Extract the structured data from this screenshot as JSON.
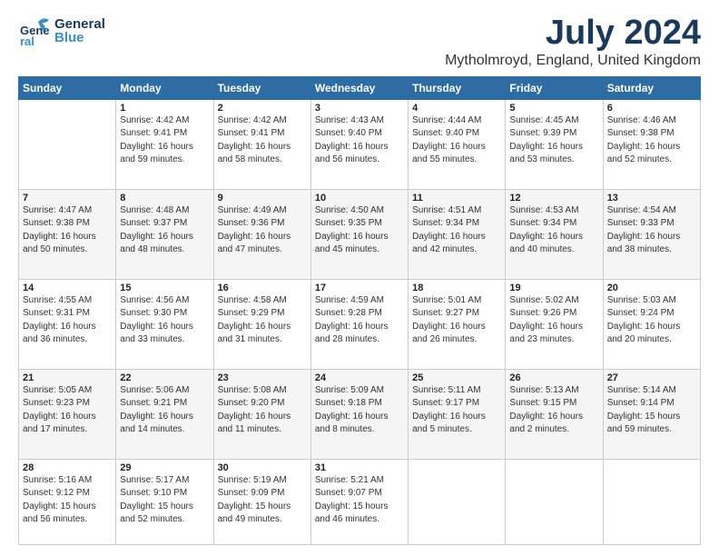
{
  "header": {
    "logo_general": "General",
    "logo_blue": "Blue",
    "month_title": "July 2024",
    "location": "Mytholmroyd, England, United Kingdom"
  },
  "days_of_week": [
    "Sunday",
    "Monday",
    "Tuesday",
    "Wednesday",
    "Thursday",
    "Friday",
    "Saturday"
  ],
  "weeks": [
    [
      {
        "day": "",
        "sunrise": "",
        "sunset": "",
        "daylight": ""
      },
      {
        "day": "1",
        "sunrise": "Sunrise: 4:42 AM",
        "sunset": "Sunset: 9:41 PM",
        "daylight": "Daylight: 16 hours and 59 minutes."
      },
      {
        "day": "2",
        "sunrise": "Sunrise: 4:42 AM",
        "sunset": "Sunset: 9:41 PM",
        "daylight": "Daylight: 16 hours and 58 minutes."
      },
      {
        "day": "3",
        "sunrise": "Sunrise: 4:43 AM",
        "sunset": "Sunset: 9:40 PM",
        "daylight": "Daylight: 16 hours and 56 minutes."
      },
      {
        "day": "4",
        "sunrise": "Sunrise: 4:44 AM",
        "sunset": "Sunset: 9:40 PM",
        "daylight": "Daylight: 16 hours and 55 minutes."
      },
      {
        "day": "5",
        "sunrise": "Sunrise: 4:45 AM",
        "sunset": "Sunset: 9:39 PM",
        "daylight": "Daylight: 16 hours and 53 minutes."
      },
      {
        "day": "6",
        "sunrise": "Sunrise: 4:46 AM",
        "sunset": "Sunset: 9:38 PM",
        "daylight": "Daylight: 16 hours and 52 minutes."
      }
    ],
    [
      {
        "day": "7",
        "sunrise": "Sunrise: 4:47 AM",
        "sunset": "Sunset: 9:38 PM",
        "daylight": "Daylight: 16 hours and 50 minutes."
      },
      {
        "day": "8",
        "sunrise": "Sunrise: 4:48 AM",
        "sunset": "Sunset: 9:37 PM",
        "daylight": "Daylight: 16 hours and 48 minutes."
      },
      {
        "day": "9",
        "sunrise": "Sunrise: 4:49 AM",
        "sunset": "Sunset: 9:36 PM",
        "daylight": "Daylight: 16 hours and 47 minutes."
      },
      {
        "day": "10",
        "sunrise": "Sunrise: 4:50 AM",
        "sunset": "Sunset: 9:35 PM",
        "daylight": "Daylight: 16 hours and 45 minutes."
      },
      {
        "day": "11",
        "sunrise": "Sunrise: 4:51 AM",
        "sunset": "Sunset: 9:34 PM",
        "daylight": "Daylight: 16 hours and 42 minutes."
      },
      {
        "day": "12",
        "sunrise": "Sunrise: 4:53 AM",
        "sunset": "Sunset: 9:34 PM",
        "daylight": "Daylight: 16 hours and 40 minutes."
      },
      {
        "day": "13",
        "sunrise": "Sunrise: 4:54 AM",
        "sunset": "Sunset: 9:33 PM",
        "daylight": "Daylight: 16 hours and 38 minutes."
      }
    ],
    [
      {
        "day": "14",
        "sunrise": "Sunrise: 4:55 AM",
        "sunset": "Sunset: 9:31 PM",
        "daylight": "Daylight: 16 hours and 36 minutes."
      },
      {
        "day": "15",
        "sunrise": "Sunrise: 4:56 AM",
        "sunset": "Sunset: 9:30 PM",
        "daylight": "Daylight: 16 hours and 33 minutes."
      },
      {
        "day": "16",
        "sunrise": "Sunrise: 4:58 AM",
        "sunset": "Sunset: 9:29 PM",
        "daylight": "Daylight: 16 hours and 31 minutes."
      },
      {
        "day": "17",
        "sunrise": "Sunrise: 4:59 AM",
        "sunset": "Sunset: 9:28 PM",
        "daylight": "Daylight: 16 hours and 28 minutes."
      },
      {
        "day": "18",
        "sunrise": "Sunrise: 5:01 AM",
        "sunset": "Sunset: 9:27 PM",
        "daylight": "Daylight: 16 hours and 26 minutes."
      },
      {
        "day": "19",
        "sunrise": "Sunrise: 5:02 AM",
        "sunset": "Sunset: 9:26 PM",
        "daylight": "Daylight: 16 hours and 23 minutes."
      },
      {
        "day": "20",
        "sunrise": "Sunrise: 5:03 AM",
        "sunset": "Sunset: 9:24 PM",
        "daylight": "Daylight: 16 hours and 20 minutes."
      }
    ],
    [
      {
        "day": "21",
        "sunrise": "Sunrise: 5:05 AM",
        "sunset": "Sunset: 9:23 PM",
        "daylight": "Daylight: 16 hours and 17 minutes."
      },
      {
        "day": "22",
        "sunrise": "Sunrise: 5:06 AM",
        "sunset": "Sunset: 9:21 PM",
        "daylight": "Daylight: 16 hours and 14 minutes."
      },
      {
        "day": "23",
        "sunrise": "Sunrise: 5:08 AM",
        "sunset": "Sunset: 9:20 PM",
        "daylight": "Daylight: 16 hours and 11 minutes."
      },
      {
        "day": "24",
        "sunrise": "Sunrise: 5:09 AM",
        "sunset": "Sunset: 9:18 PM",
        "daylight": "Daylight: 16 hours and 8 minutes."
      },
      {
        "day": "25",
        "sunrise": "Sunrise: 5:11 AM",
        "sunset": "Sunset: 9:17 PM",
        "daylight": "Daylight: 16 hours and 5 minutes."
      },
      {
        "day": "26",
        "sunrise": "Sunrise: 5:13 AM",
        "sunset": "Sunset: 9:15 PM",
        "daylight": "Daylight: 16 hours and 2 minutes."
      },
      {
        "day": "27",
        "sunrise": "Sunrise: 5:14 AM",
        "sunset": "Sunset: 9:14 PM",
        "daylight": "Daylight: 15 hours and 59 minutes."
      }
    ],
    [
      {
        "day": "28",
        "sunrise": "Sunrise: 5:16 AM",
        "sunset": "Sunset: 9:12 PM",
        "daylight": "Daylight: 15 hours and 56 minutes."
      },
      {
        "day": "29",
        "sunrise": "Sunrise: 5:17 AM",
        "sunset": "Sunset: 9:10 PM",
        "daylight": "Daylight: 15 hours and 52 minutes."
      },
      {
        "day": "30",
        "sunrise": "Sunrise: 5:19 AM",
        "sunset": "Sunset: 9:09 PM",
        "daylight": "Daylight: 15 hours and 49 minutes."
      },
      {
        "day": "31",
        "sunrise": "Sunrise: 5:21 AM",
        "sunset": "Sunset: 9:07 PM",
        "daylight": "Daylight: 15 hours and 46 minutes."
      },
      {
        "day": "",
        "sunrise": "",
        "sunset": "",
        "daylight": ""
      },
      {
        "day": "",
        "sunrise": "",
        "sunset": "",
        "daylight": ""
      },
      {
        "day": "",
        "sunrise": "",
        "sunset": "",
        "daylight": ""
      }
    ]
  ]
}
